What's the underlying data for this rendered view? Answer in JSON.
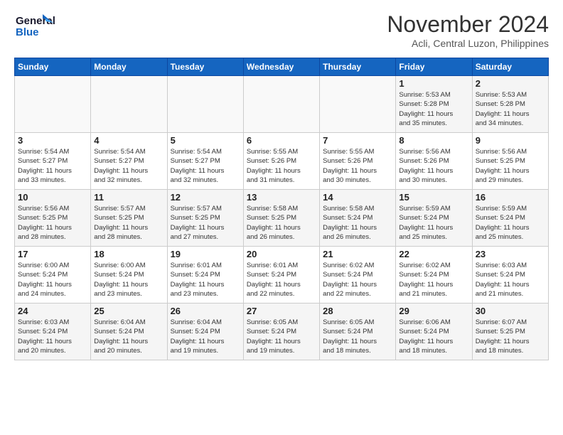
{
  "header": {
    "logo_line1": "General",
    "logo_line2": "Blue",
    "month": "November 2024",
    "location": "Acli, Central Luzon, Philippines"
  },
  "weekdays": [
    "Sunday",
    "Monday",
    "Tuesday",
    "Wednesday",
    "Thursday",
    "Friday",
    "Saturday"
  ],
  "weeks": [
    [
      {
        "day": "",
        "info": ""
      },
      {
        "day": "",
        "info": ""
      },
      {
        "day": "",
        "info": ""
      },
      {
        "day": "",
        "info": ""
      },
      {
        "day": "",
        "info": ""
      },
      {
        "day": "1",
        "info": "Sunrise: 5:53 AM\nSunset: 5:28 PM\nDaylight: 11 hours\nand 35 minutes."
      },
      {
        "day": "2",
        "info": "Sunrise: 5:53 AM\nSunset: 5:28 PM\nDaylight: 11 hours\nand 34 minutes."
      }
    ],
    [
      {
        "day": "3",
        "info": "Sunrise: 5:54 AM\nSunset: 5:27 PM\nDaylight: 11 hours\nand 33 minutes."
      },
      {
        "day": "4",
        "info": "Sunrise: 5:54 AM\nSunset: 5:27 PM\nDaylight: 11 hours\nand 32 minutes."
      },
      {
        "day": "5",
        "info": "Sunrise: 5:54 AM\nSunset: 5:27 PM\nDaylight: 11 hours\nand 32 minutes."
      },
      {
        "day": "6",
        "info": "Sunrise: 5:55 AM\nSunset: 5:26 PM\nDaylight: 11 hours\nand 31 minutes."
      },
      {
        "day": "7",
        "info": "Sunrise: 5:55 AM\nSunset: 5:26 PM\nDaylight: 11 hours\nand 30 minutes."
      },
      {
        "day": "8",
        "info": "Sunrise: 5:56 AM\nSunset: 5:26 PM\nDaylight: 11 hours\nand 30 minutes."
      },
      {
        "day": "9",
        "info": "Sunrise: 5:56 AM\nSunset: 5:25 PM\nDaylight: 11 hours\nand 29 minutes."
      }
    ],
    [
      {
        "day": "10",
        "info": "Sunrise: 5:56 AM\nSunset: 5:25 PM\nDaylight: 11 hours\nand 28 minutes."
      },
      {
        "day": "11",
        "info": "Sunrise: 5:57 AM\nSunset: 5:25 PM\nDaylight: 11 hours\nand 28 minutes."
      },
      {
        "day": "12",
        "info": "Sunrise: 5:57 AM\nSunset: 5:25 PM\nDaylight: 11 hours\nand 27 minutes."
      },
      {
        "day": "13",
        "info": "Sunrise: 5:58 AM\nSunset: 5:25 PM\nDaylight: 11 hours\nand 26 minutes."
      },
      {
        "day": "14",
        "info": "Sunrise: 5:58 AM\nSunset: 5:24 PM\nDaylight: 11 hours\nand 26 minutes."
      },
      {
        "day": "15",
        "info": "Sunrise: 5:59 AM\nSunset: 5:24 PM\nDaylight: 11 hours\nand 25 minutes."
      },
      {
        "day": "16",
        "info": "Sunrise: 5:59 AM\nSunset: 5:24 PM\nDaylight: 11 hours\nand 25 minutes."
      }
    ],
    [
      {
        "day": "17",
        "info": "Sunrise: 6:00 AM\nSunset: 5:24 PM\nDaylight: 11 hours\nand 24 minutes."
      },
      {
        "day": "18",
        "info": "Sunrise: 6:00 AM\nSunset: 5:24 PM\nDaylight: 11 hours\nand 23 minutes."
      },
      {
        "day": "19",
        "info": "Sunrise: 6:01 AM\nSunset: 5:24 PM\nDaylight: 11 hours\nand 23 minutes."
      },
      {
        "day": "20",
        "info": "Sunrise: 6:01 AM\nSunset: 5:24 PM\nDaylight: 11 hours\nand 22 minutes."
      },
      {
        "day": "21",
        "info": "Sunrise: 6:02 AM\nSunset: 5:24 PM\nDaylight: 11 hours\nand 22 minutes."
      },
      {
        "day": "22",
        "info": "Sunrise: 6:02 AM\nSunset: 5:24 PM\nDaylight: 11 hours\nand 21 minutes."
      },
      {
        "day": "23",
        "info": "Sunrise: 6:03 AM\nSunset: 5:24 PM\nDaylight: 11 hours\nand 21 minutes."
      }
    ],
    [
      {
        "day": "24",
        "info": "Sunrise: 6:03 AM\nSunset: 5:24 PM\nDaylight: 11 hours\nand 20 minutes."
      },
      {
        "day": "25",
        "info": "Sunrise: 6:04 AM\nSunset: 5:24 PM\nDaylight: 11 hours\nand 20 minutes."
      },
      {
        "day": "26",
        "info": "Sunrise: 6:04 AM\nSunset: 5:24 PM\nDaylight: 11 hours\nand 19 minutes."
      },
      {
        "day": "27",
        "info": "Sunrise: 6:05 AM\nSunset: 5:24 PM\nDaylight: 11 hours\nand 19 minutes."
      },
      {
        "day": "28",
        "info": "Sunrise: 6:05 AM\nSunset: 5:24 PM\nDaylight: 11 hours\nand 18 minutes."
      },
      {
        "day": "29",
        "info": "Sunrise: 6:06 AM\nSunset: 5:24 PM\nDaylight: 11 hours\nand 18 minutes."
      },
      {
        "day": "30",
        "info": "Sunrise: 6:07 AM\nSunset: 5:25 PM\nDaylight: 11 hours\nand 18 minutes."
      }
    ]
  ]
}
